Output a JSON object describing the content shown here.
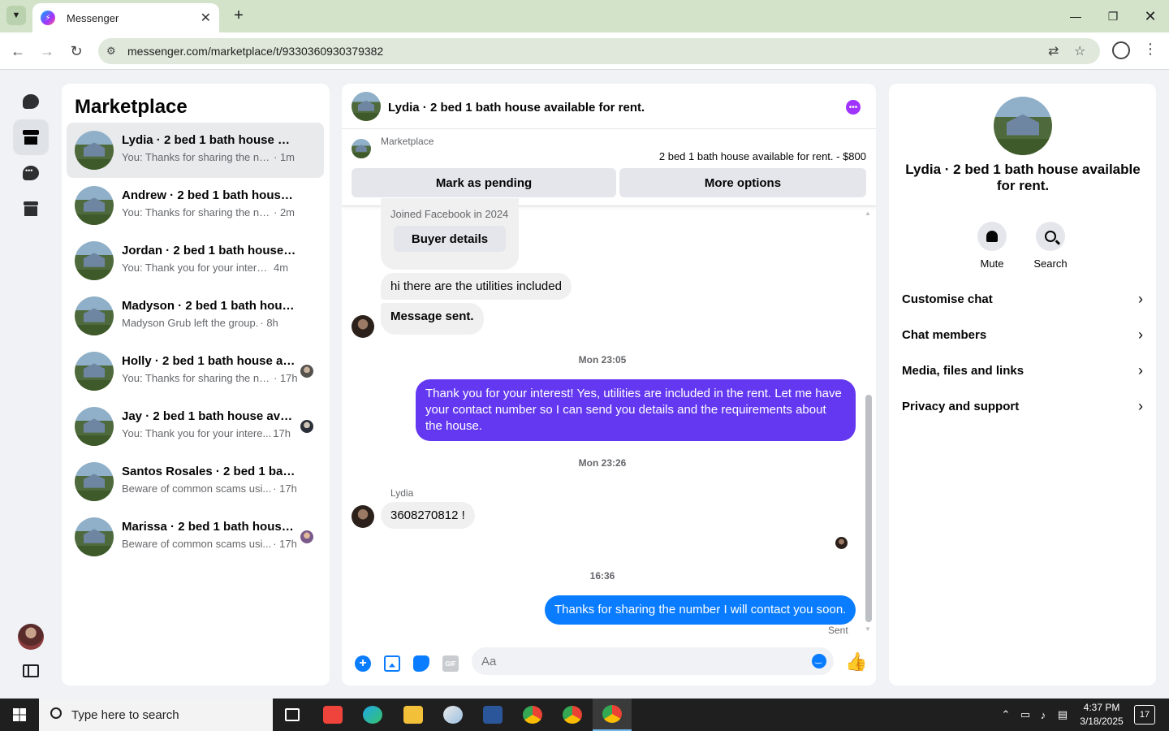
{
  "browser": {
    "tab_title": "Messenger",
    "url": "messenger.com/marketplace/t/9330360930379382",
    "window_controls": [
      "minimize-icon",
      "maximize-icon",
      "close-icon"
    ]
  },
  "rail": {
    "items": [
      "chats-icon",
      "marketplace-icon",
      "requests-icon",
      "archive-icon"
    ]
  },
  "list": {
    "title": "Marketplace",
    "conversations": [
      {
        "name": "Lydia · 2 bed 1 bath house av...",
        "preview": "You: Thanks for sharing the nu...",
        "time": "· 1m"
      },
      {
        "name": "Andrew · 2 bed 1 bath house ...",
        "preview": "You: Thanks for sharing the nu...",
        "time": "· 2m"
      },
      {
        "name": "Jordan · 2 bed 1 bath house a...",
        "preview": "You: Thank you for your interes...",
        "time": "4m"
      },
      {
        "name": "Madyson · 2 bed 1 bath hous...",
        "preview": "Madyson Grub left the group.",
        "time": "· 8h"
      },
      {
        "name": "Holly · 2 bed 1 bath house av...",
        "preview": "You: Thanks for sharing the nu...",
        "time": "· 17h"
      },
      {
        "name": "Jay · 2 bed 1 bath house avail...",
        "preview": "You: Thank you for your intere...",
        "time": "17h"
      },
      {
        "name": "Santos Rosales · 2 bed 1 bath ...",
        "preview": "Beware of common scams usi...",
        "time": "· 17h"
      },
      {
        "name": "Marissa · 2 bed 1 bath house ...",
        "preview": "Beware of common scams usi...",
        "time": "· 17h"
      }
    ]
  },
  "chat": {
    "title": "Lydia · 2 bed 1 bath house available for rent.",
    "marketplace_label": "Marketplace",
    "listing": "2 bed 1 bath house available for rent. - $800",
    "mark_pending": "Mark as pending",
    "more_options": "More options",
    "joined": "Joined Facebook in 2024",
    "buyer_details": "Buyer details",
    "msg1": "hi there are the utilities included",
    "msg2": "Message sent.",
    "ts1": "Mon 23:05",
    "msg3": "Thank you for your interest! Yes, utilities are included in the rent. Let me have your contact number so I can send you details and the requirements about the house.",
    "ts2": "Mon 23:26",
    "sender": "Lydia",
    "msg4": "3608270812 !",
    "ts3": "16:36",
    "msg5": "Thanks for sharing the number I will contact you soon.",
    "status": "Sent",
    "composer_placeholder": "Aa",
    "colors": {
      "purple_bubble": "#6338f0",
      "blue_bubble": "#0a7cff",
      "accent": "#a033ff"
    }
  },
  "info": {
    "title": "Lydia · 2 bed 1 bath house available for rent.",
    "mute": "Mute",
    "search": "Search",
    "rows": [
      "Customise chat",
      "Chat members",
      "Media, files and links",
      "Privacy and support"
    ]
  },
  "taskbar": {
    "search_placeholder": "Type here to search",
    "time": "4:37 PM",
    "date": "3/18/2025",
    "notifications": "17"
  }
}
